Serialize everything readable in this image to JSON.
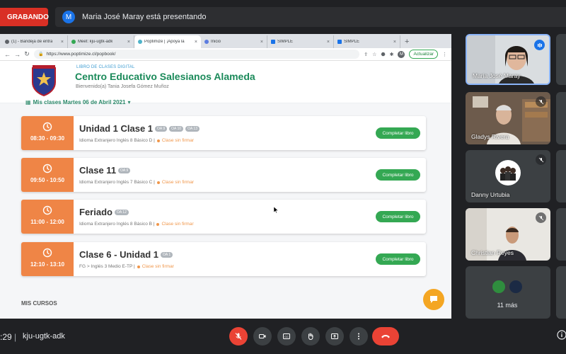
{
  "meet": {
    "recording_label": "GRABANDO",
    "presenter_initial": "M",
    "presenting_text": "Maria José Maray está presentando",
    "clock": ":29",
    "separator": "|",
    "meeting_code": "kju-ugtk-adk"
  },
  "browser": {
    "tabs": [
      {
        "label": "(1) - Bandeja de entra",
        "active": false
      },
      {
        "label": "Meet: kju-ugtk-adk",
        "active": false
      },
      {
        "label": "Poptimize | ¡Apoya la",
        "active": true
      },
      {
        "label": "Inicio",
        "active": false
      },
      {
        "label": "SIMPLE",
        "active": false
      },
      {
        "label": "SIMPLE",
        "active": false
      }
    ],
    "new_tab": "+",
    "url": "https://www.poptimize.cl/popbook/",
    "profile_initial": "M",
    "update_label": "Actualizar"
  },
  "site": {
    "kicker": "LIBRO DE CLASES DIGITAL",
    "school_name": "Centro Educativo Salesianos Alameda",
    "welcome": "Bienvenido(a) Tania Josefa Gómez Muñoz",
    "my_classes": "Mis clases Martes 06 de Abril 2021",
    "classes": [
      {
        "time": "08:30 - 09:30",
        "title": "Unidad 1 Clase 1",
        "tags": [
          "OA 9",
          "OA 10",
          "OA 13"
        ],
        "subject": "Idioma Extranjero Inglés 8 Básico D |",
        "status": "Clase sin firmar",
        "action": "Completar libro"
      },
      {
        "time": "09:50 - 10:50",
        "title": "Clase 11",
        "tags": [
          "OA 9"
        ],
        "subject": "Idioma Extranjero Inglés 7 Básico C |",
        "status": "Clase sin firmar",
        "action": "Completar libro"
      },
      {
        "time": "11:00 - 12:00",
        "title": "Feriado",
        "tags": [
          "OA 12"
        ],
        "subject": "Idioma Extranjero Inglés 8 Básico B |",
        "status": "Clase sin firmar",
        "action": "Completar libro"
      },
      {
        "time": "12:10 - 13:10",
        "title": "Clase 6 - Unidad 1",
        "tags": [
          "OA 1"
        ],
        "subject": "FG > Inglés 3 Medio E-TP |",
        "status": "Clase sin firmar",
        "action": "Completar libro"
      }
    ],
    "my_courses": "MIS CURSOS"
  },
  "participants": [
    {
      "name": "Maria José Maray",
      "speaking": true
    },
    {
      "name": "Gladys Rivera",
      "speaking": false
    },
    {
      "name": "Danny Urtubia",
      "speaking": false
    },
    {
      "name": "Christian Reyes",
      "speaking": false
    }
  ],
  "more_count_label": "11 más",
  "colors": {
    "meet_bg": "#202124",
    "recording_red": "#d93025",
    "school_green": "#1b8a5a",
    "time_orange": "#ef8546",
    "complete_green": "#34a853",
    "chat_fab": "#f4a623"
  }
}
